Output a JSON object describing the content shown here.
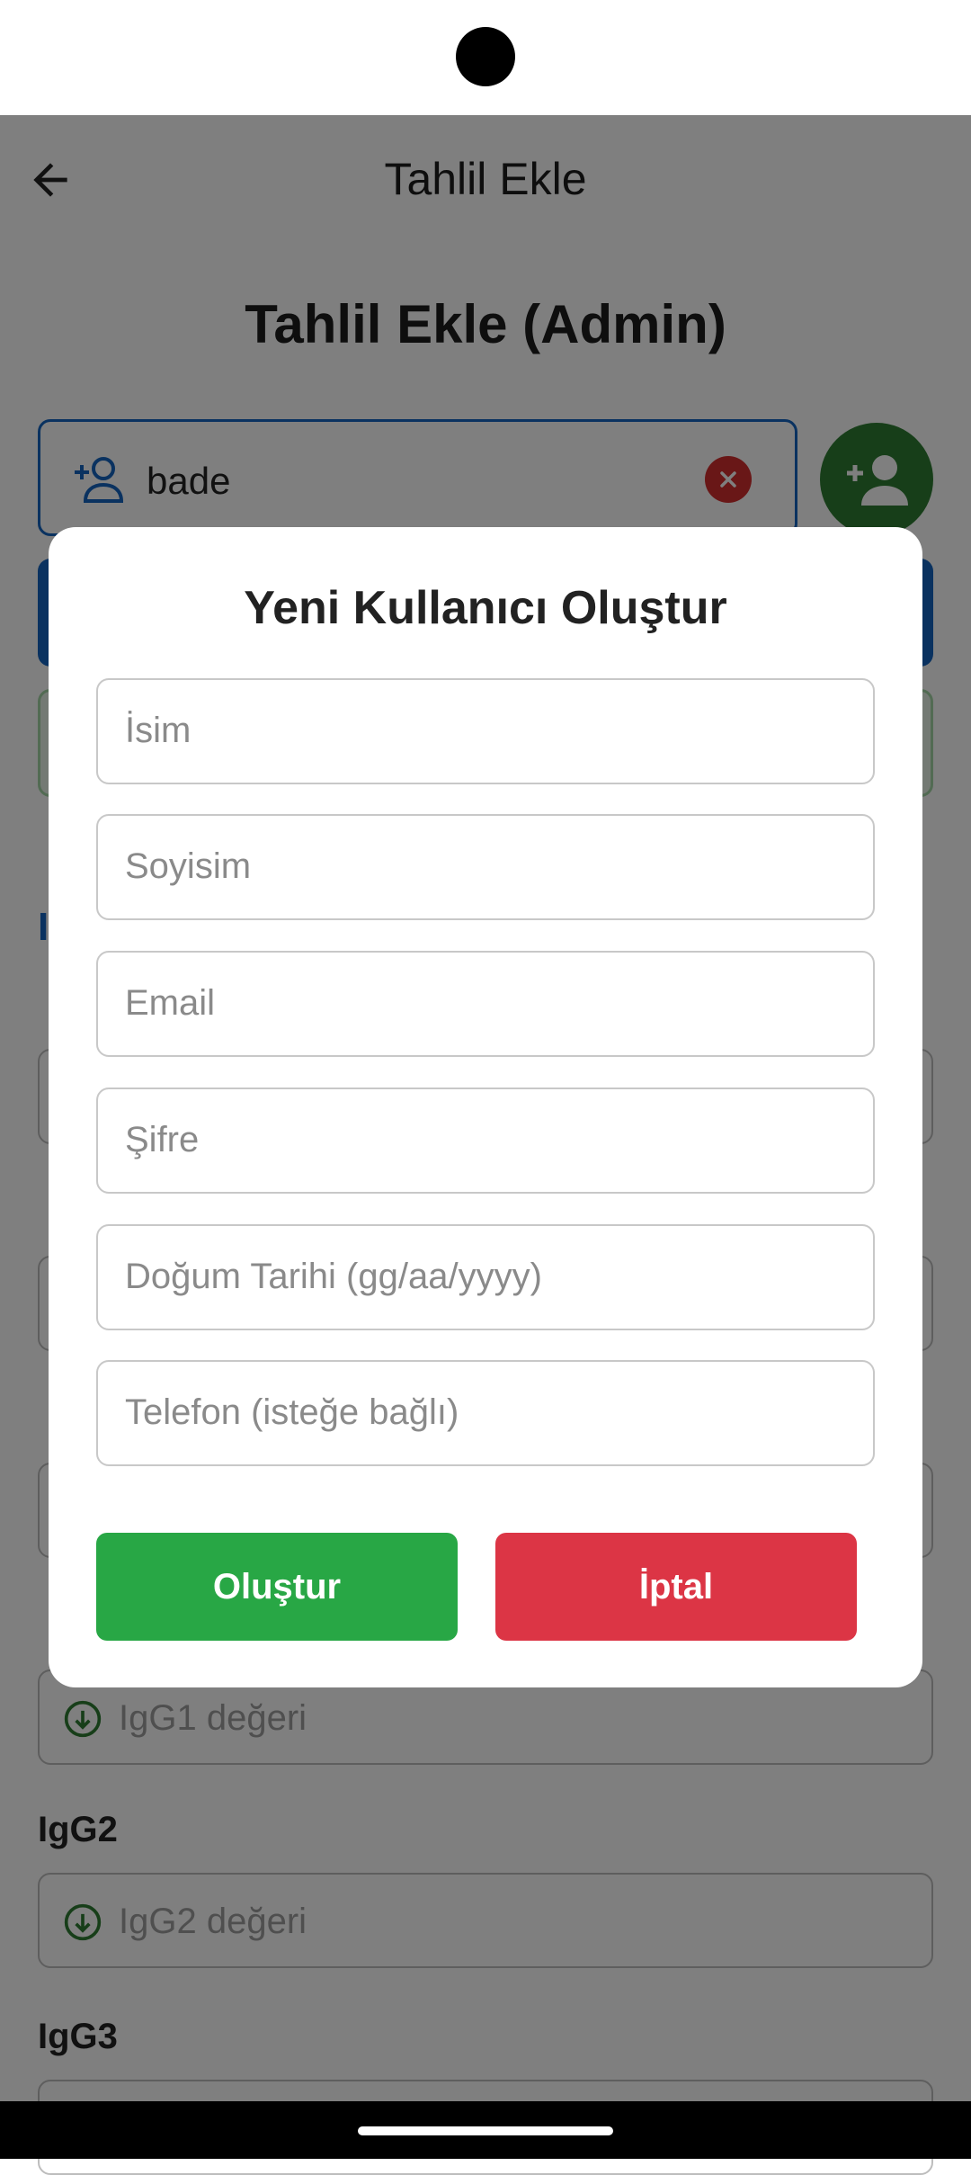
{
  "app_bar": {
    "title": "Tahlil Ekle"
  },
  "page": {
    "title": "Tahlil Ekle (Admin)"
  },
  "search": {
    "value": "bade"
  },
  "background_fields": [
    {
      "label": "IgG2",
      "placeholder": "IgG2 değeri"
    },
    {
      "label": "IgG3",
      "placeholder": ""
    }
  ],
  "background_placeholders": {
    "igg1": "IgG1 değeri"
  },
  "dialog": {
    "title": "Yeni Kullanıcı Oluştur",
    "fields": {
      "first_name": "İsim",
      "last_name": "Soyisim",
      "email": "Email",
      "password": "Şifre",
      "birth_date": "Doğum Tarihi (gg/aa/yyyy)",
      "phone": "Telefon (isteğe bağlı)"
    },
    "create_label": "Oluştur",
    "cancel_label": "İptal"
  },
  "colors": {
    "primary_blue": "#1565c0",
    "fab_green": "#2e7d32",
    "create_green": "#28a745",
    "cancel_red": "#dc3545",
    "clear_red": "#d32f2f"
  },
  "icons": [
    "back-arrow-icon",
    "person-add-icon",
    "close-icon",
    "arrow-circle-down-icon"
  ]
}
